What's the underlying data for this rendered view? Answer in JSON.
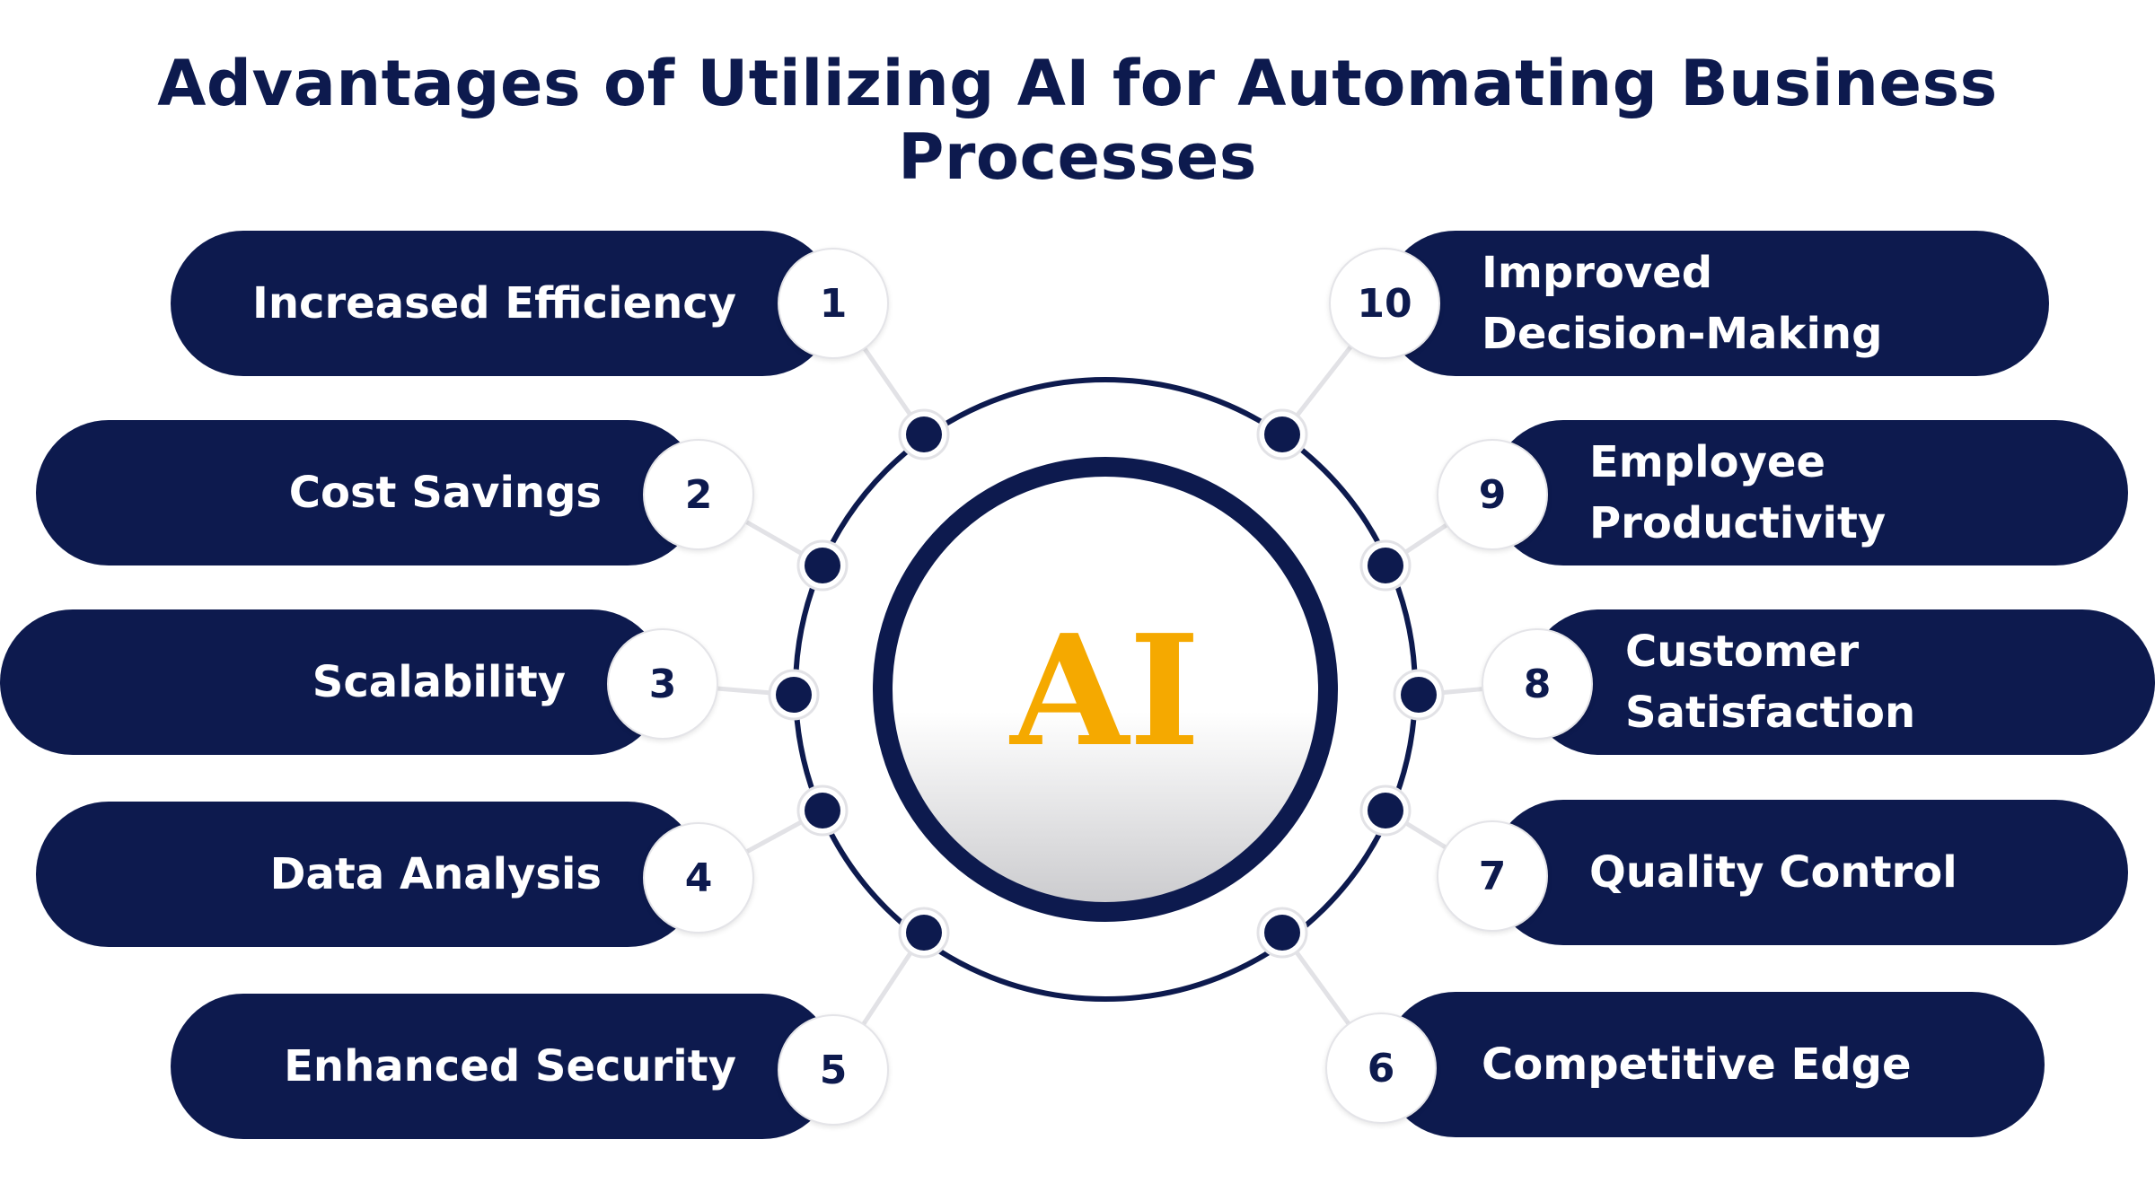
{
  "title": "Advantages of Utilizing AI for Automating Business Processes",
  "center_label": "AI",
  "colors": {
    "navy": "#0d1a4e",
    "gold": "#f5a900",
    "badge_bg": "#ffffff"
  },
  "items": [
    {
      "number": "1",
      "label": "Increased Efficiency"
    },
    {
      "number": "2",
      "label": "Cost Savings"
    },
    {
      "number": "3",
      "label": "Scalability"
    },
    {
      "number": "4",
      "label": "Data Analysis"
    },
    {
      "number": "5",
      "label": "Enhanced Security"
    },
    {
      "number": "6",
      "label": "Competitive Edge"
    },
    {
      "number": "7",
      "label": "Quality Control"
    },
    {
      "number": "8",
      "label": "Customer Satisfaction"
    },
    {
      "number": "9",
      "label": "Employee Productivity"
    },
    {
      "number": "10",
      "label": "Improved Decision-Making"
    }
  ]
}
